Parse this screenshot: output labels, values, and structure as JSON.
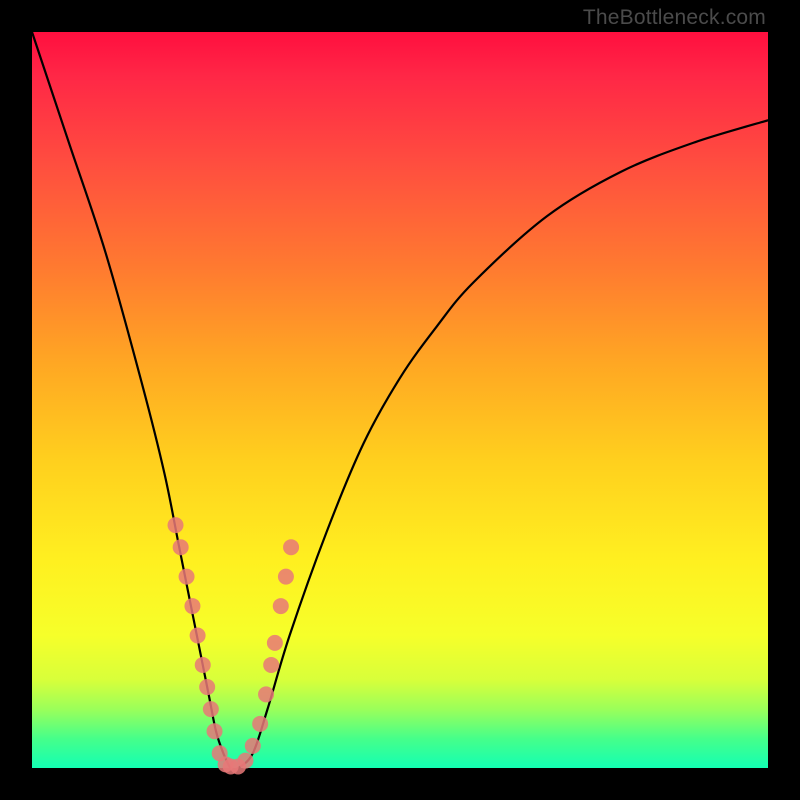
{
  "attribution": "TheBottleneck.com",
  "chart_data": {
    "type": "line",
    "title": "",
    "xlabel": "",
    "ylabel": "",
    "xlim": [
      0,
      100
    ],
    "ylim": [
      0,
      100
    ],
    "series": [
      {
        "name": "curve",
        "x": [
          0,
          5,
          10,
          15,
          18,
          20,
          22,
          24,
          25,
          26,
          27,
          28,
          30,
          32,
          35,
          40,
          45,
          50,
          55,
          60,
          70,
          80,
          90,
          100
        ],
        "y": [
          100,
          85,
          70,
          52,
          40,
          30,
          20,
          10,
          5,
          2,
          0,
          0,
          2,
          8,
          18,
          32,
          44,
          53,
          60,
          66,
          75,
          81,
          85,
          88
        ]
      }
    ],
    "markers": {
      "name": "highlighted-points",
      "color": "#e87878",
      "radius_px": 8,
      "x": [
        19.5,
        20.2,
        21.0,
        21.8,
        22.5,
        23.2,
        23.8,
        24.3,
        24.8,
        25.5,
        26.3,
        27.0,
        28.0,
        29.0,
        30.0,
        31.0,
        31.8,
        32.5,
        33.0,
        33.8,
        34.5,
        35.2
      ],
      "y": [
        33,
        30,
        26,
        22,
        18,
        14,
        11,
        8,
        5,
        2,
        0.5,
        0.2,
        0.2,
        1,
        3,
        6,
        10,
        14,
        17,
        22,
        26,
        30
      ]
    }
  }
}
